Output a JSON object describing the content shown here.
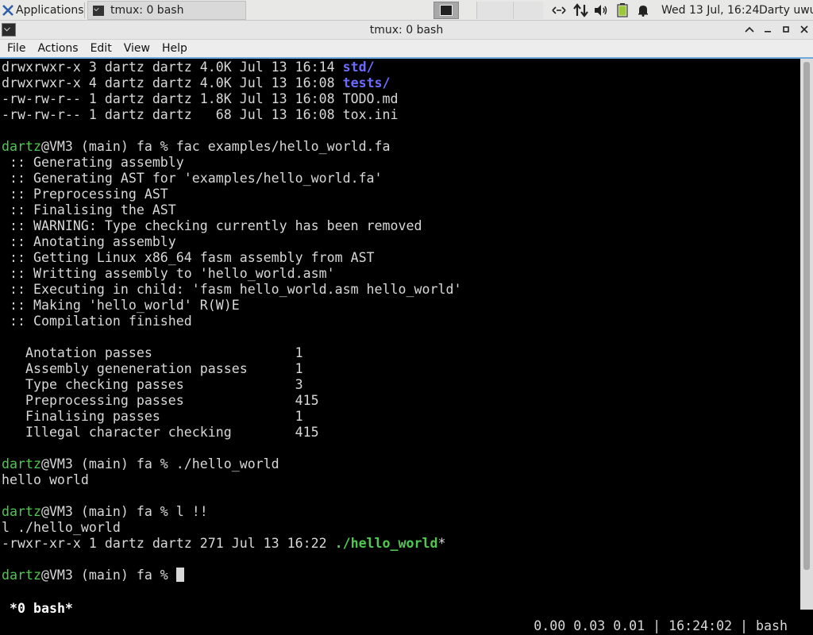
{
  "panel": {
    "applications": "Applications",
    "task": "tmux: 0 bash",
    "clock": "Wed 13 Jul, 16:24",
    "user": "Darty uwu"
  },
  "window": {
    "title": "tmux: 0 bash"
  },
  "menubar": {
    "items": [
      "File",
      "Actions",
      "Edit",
      "View",
      "Help"
    ]
  },
  "terminal": {
    "lines": [
      "drwxrwxr-x 3 dartz dartz 4.0K Jul 13 16:14 ",
      "std/",
      "drwxrwxr-x 4 dartz dartz 4.0K Jul 13 16:08 ",
      "tests/",
      "-rw-rw-r-- 1 dartz dartz 1.8K Jul 13 16:08 TODO.md",
      "-rw-rw-r-- 1 dartz dartz   68 Jul 13 16:08 tox.ini",
      "dartz",
      "@VM3 (main) fa % fac examples/hello_world.fa",
      " :: Generating assembly",
      " :: Generating AST for 'examples/hello_world.fa'",
      " :: Preprocessing AST",
      " :: Finalising the AST",
      " :: WARNING: Type checking currently has been removed",
      " :: Anotating assembly",
      " :: Getting Linux x86_64 fasm assembly from AST",
      " :: Writting assembly to 'hello_world.asm'",
      " :: Executing in child: 'fasm hello_world.asm hello_world'",
      " :: Making 'hello_world' R(W)E",
      " :: Compilation finished",
      "   Anotation passes                  1",
      "   Assembly geneneration passes      1",
      "   Type checking passes              3",
      "   Preprocessing passes              415",
      "   Finalising passes                 1",
      "   Illegal character checking        415",
      "dartz",
      "@VM3 (main) fa % ./hello_world",
      "hello world",
      "dartz",
      "@VM3 (main) fa % l !!",
      "l ./hello_world",
      "-rwxr-xr-x 1 dartz dartz 271 Jul 13 16:22 ",
      "./hello_world",
      "*",
      "dartz",
      "@VM3 (main) fa % "
    ]
  },
  "tmux_status": {
    "left": "*0 bash*",
    "right": "0.00 0.03 0.01 | 16:24:02 | bash"
  },
  "colors": {
    "prompt_user": "#4fc84f",
    "directory": "#6b6bff",
    "executable": "#4fc84f",
    "focus_accent": "#6fa9de"
  },
  "icons": {
    "panel": [
      "xfce-logo-icon",
      "terminal-icon",
      "network-icon",
      "transfer-icon",
      "volume-icon",
      "battery-icon",
      "notification-bell-icon"
    ],
    "window": [
      "terminal-icon",
      "maximize-icon",
      "minimize-icon",
      "restore-icon",
      "close-icon"
    ]
  }
}
